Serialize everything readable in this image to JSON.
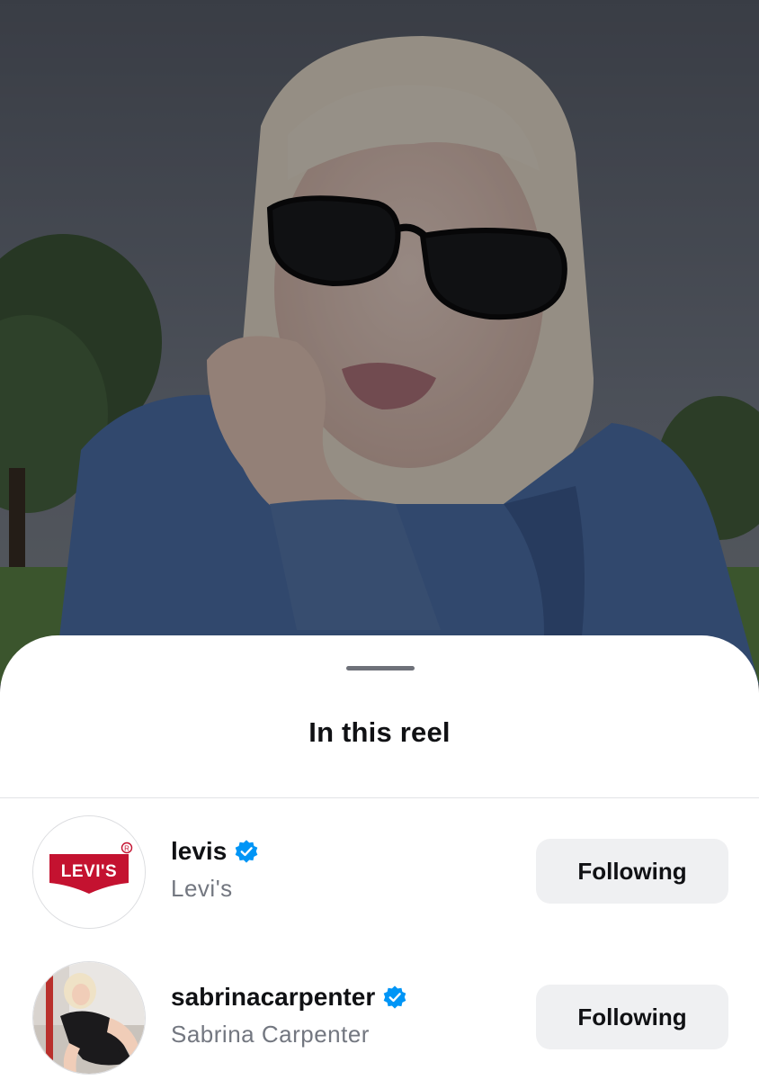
{
  "sheet": {
    "title": "In this reel"
  },
  "accounts": [
    {
      "username": "levis",
      "display_name": "Levi's",
      "verified": true,
      "follow_label": "Following",
      "avatar_logo_text": "LEVI'S"
    },
    {
      "username": "sabrinacarpenter",
      "display_name": "Sabrina Carpenter",
      "verified": true,
      "follow_label": "Following"
    }
  ],
  "colors": {
    "verified_blue": "#0095f6",
    "levis_red": "#c41230",
    "button_bg": "#eff0f2"
  }
}
